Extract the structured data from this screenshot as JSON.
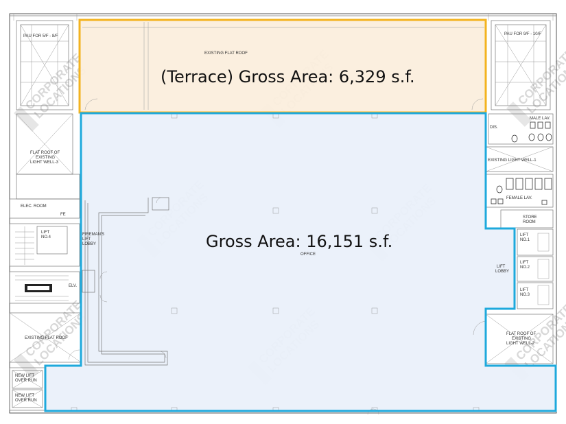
{
  "terrace": {
    "area_label": "(Terrace) Gross Area: 6,329 s.f.",
    "roof_label": "EXISTING FLAT ROOF",
    "fill": "#fbeedd",
    "outline": "#f3b31f"
  },
  "office": {
    "area_label": "Gross Area: 16,151 s.f.",
    "room_label": "OFFICE",
    "fill": "#eaf0fa",
    "outline": "#1ea9dc"
  },
  "rooms": {
    "pau_left": "PAU FOR 5/F - 8/F",
    "pau_right": "PAU FOR 9/F - 10/F",
    "flat_roof_light_well_3": [
      "FLAT ROOF OF",
      "EXISTING",
      "LIGHT WELL-3"
    ],
    "elec_room": "ELEC. ROOM",
    "lift_4": [
      "LIFT",
      "NO.4"
    ],
    "firemans_lift_lobby": [
      "FIREMAN'S",
      "LIFT",
      "LOBBY"
    ],
    "existing_flat_roof": "EXISTING FLAT ROOF",
    "new_lift_1": [
      "NEW LIFT",
      "OVER RUN"
    ],
    "new_lift_2": [
      "NEW LIFT",
      "OVER RUN"
    ],
    "dis": "DIS.",
    "male_lav": "MALE LAV.",
    "existing_light_well_1": "EXISTING LIGHT WELL-1",
    "female_lav": "FEMALE LAV.",
    "store_room": [
      "STORE",
      "ROOM"
    ],
    "lift_1": [
      "LIFT",
      "NO.1"
    ],
    "lift_2": [
      "LIFT",
      "NO.2"
    ],
    "lift_3": [
      "LIFT",
      "NO.3"
    ],
    "lift_lobby": [
      "LIFT",
      "LOBBY"
    ],
    "flat_roof_light_well_2": [
      "FLAT ROOF OF",
      "EXISTING",
      "LIGHT WELL-2"
    ],
    "elv": "ELV.",
    "fe": "FE"
  },
  "watermark": [
    "CORPORATE",
    "LOCATIONS"
  ]
}
